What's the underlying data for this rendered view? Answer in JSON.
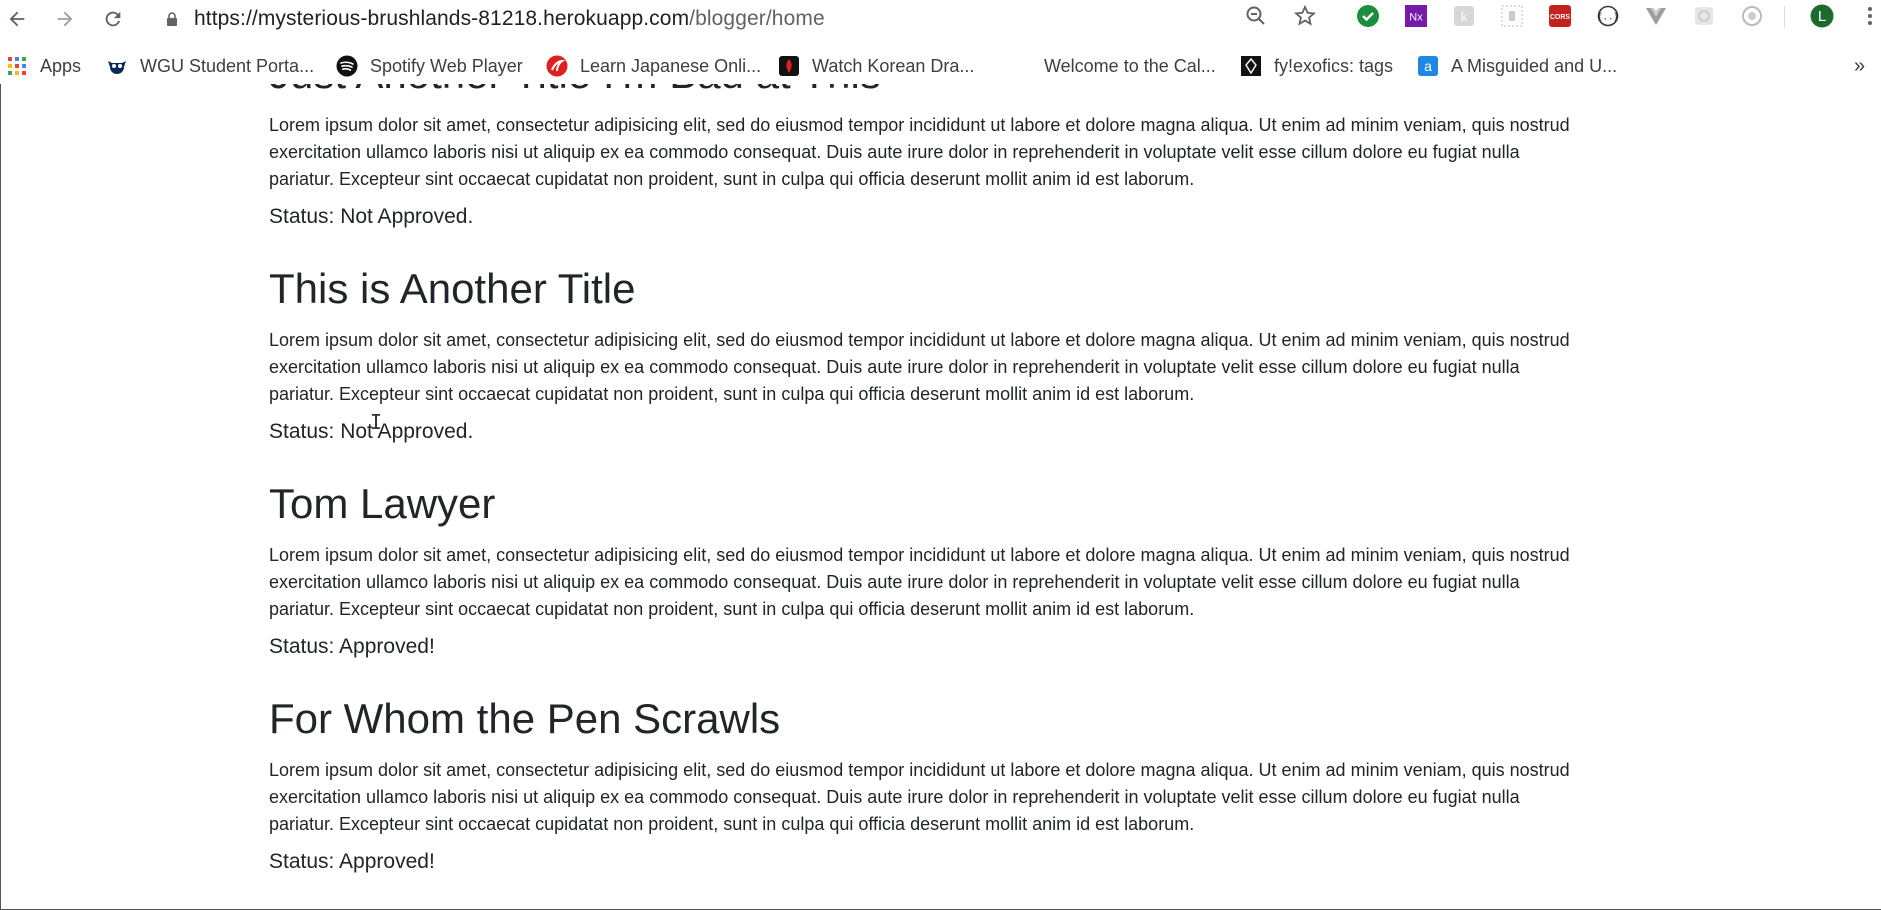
{
  "browser": {
    "url_base": "https://mysterious-brushlands-81218.herokuapp.com",
    "url_path": "/blogger/home",
    "profile_initial": "L",
    "icons": [
      "back-icon",
      "forward-icon",
      "reload-icon",
      "lock-icon",
      "zoom-icon",
      "star-icon",
      "extension-check-icon",
      "onenote-icon",
      "extension-icon",
      "extension-icon",
      "cors-icon",
      "extension-icon",
      "vue-icon",
      "extension-icon",
      "extension-icon",
      "menu-icon"
    ]
  },
  "bookmarks": {
    "items": [
      {
        "label": "Apps",
        "icon": "apps-grid-icon"
      },
      {
        "label": "WGU Student Porta...",
        "icon": "owl-icon"
      },
      {
        "label": "Spotify Web Player",
        "icon": "spotify-icon"
      },
      {
        "label": "Learn Japanese Onli...",
        "icon": "japanese-icon"
      },
      {
        "label": "Watch Korean Dra...",
        "icon": "korean-icon"
      },
      {
        "label": "Welcome to the Cal...",
        "icon": ""
      },
      {
        "label": "fy!exofics: tags",
        "icon": "tumblr-icon"
      },
      {
        "label": "A Misguided and U...",
        "icon": "a-icon"
      }
    ],
    "overflow": "»"
  },
  "posts": [
    {
      "title": "Just Another Title I'm Bad at This",
      "body": "Lorem ipsum dolor sit amet, consectetur adipisicing elit, sed do eiusmod tempor incididunt ut labore et dolore magna aliqua. Ut enim ad minim veniam, quis nostrud exercitation ullamco laboris nisi ut aliquip ex ea commodo consequat. Duis aute irure dolor in reprehenderit in voluptate velit esse cillum dolore eu fugiat nulla pariatur. Excepteur sint occaecat cupidatat non proident, sunt in culpa qui officia deserunt mollit anim id est laborum.",
      "status": "Status: Not Approved."
    },
    {
      "title": "This is Another Title",
      "body": "Lorem ipsum dolor sit amet, consectetur adipisicing elit, sed do eiusmod tempor incididunt ut labore et dolore magna aliqua. Ut enim ad minim veniam, quis nostrud exercitation ullamco laboris nisi ut aliquip ex ea commodo consequat. Duis aute irure dolor in reprehenderit in voluptate velit esse cillum dolore eu fugiat nulla pariatur. Excepteur sint occaecat cupidatat non proident, sunt in culpa qui officia deserunt mollit anim id est laborum.",
      "status": "Status: Not Approved."
    },
    {
      "title": "Tom Lawyer",
      "body": "Lorem ipsum dolor sit amet, consectetur adipisicing elit, sed do eiusmod tempor incididunt ut labore et dolore magna aliqua. Ut enim ad minim veniam, quis nostrud exercitation ullamco laboris nisi ut aliquip ex ea commodo consequat. Duis aute irure dolor in reprehenderit in voluptate velit esse cillum dolore eu fugiat nulla pariatur. Excepteur sint occaecat cupidatat non proident, sunt in culpa qui officia deserunt mollit anim id est laborum.",
      "status": "Status: Approved!"
    },
    {
      "title": "For Whom the Pen Scrawls",
      "body": "Lorem ipsum dolor sit amet, consectetur adipisicing elit, sed do eiusmod tempor incididunt ut labore et dolore magna aliqua. Ut enim ad minim veniam, quis nostrud exercitation ullamco laboris nisi ut aliquip ex ea commodo consequat. Duis aute irure dolor in reprehenderit in voluptate velit esse cillum dolore eu fugiat nulla pariatur. Excepteur sint occaecat cupidatat non proident, sunt in culpa qui officia deserunt mollit anim id est laborum.",
      "status": "Status: Approved!"
    }
  ],
  "colors": {
    "accent_green": "#1e8e3e",
    "profile_bg": "#1b6b2f",
    "cors_red": "#c5221f",
    "onenote_purple": "#7719aa"
  }
}
